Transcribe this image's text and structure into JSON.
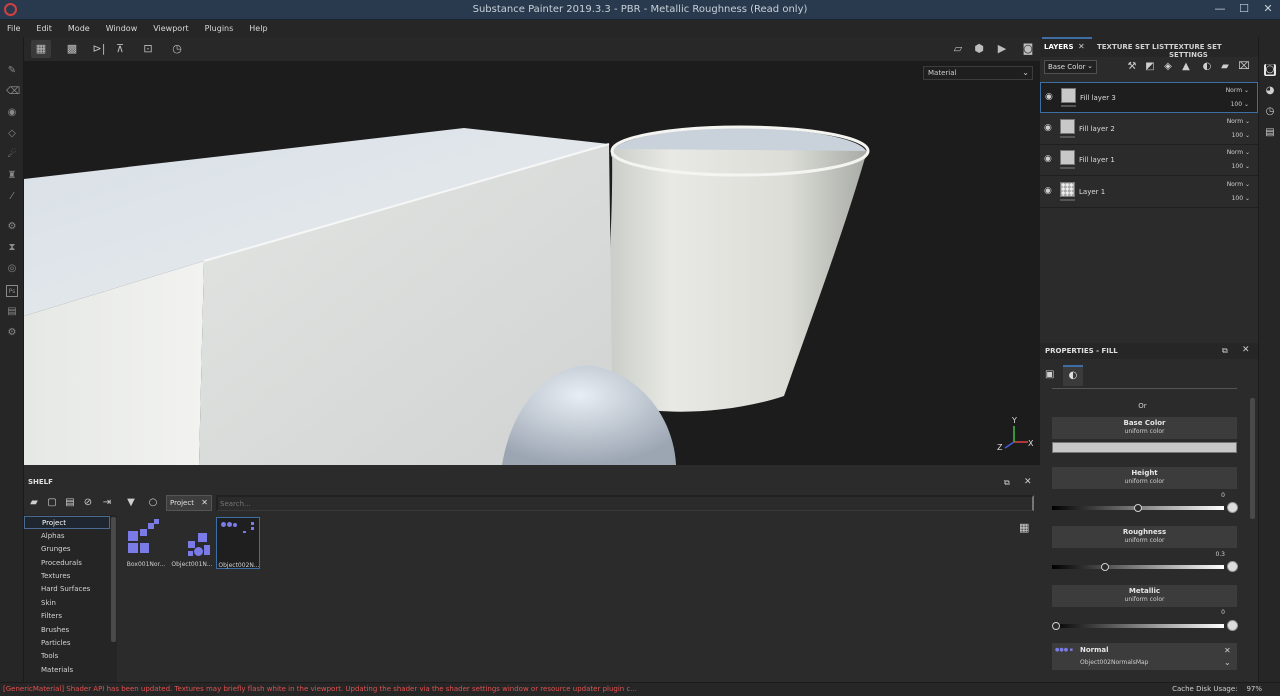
{
  "window": {
    "title": "Substance Painter 2019.3.3 - PBR - Metallic Roughness (Read only)",
    "minimize": "—",
    "maximize": "☐",
    "close": "✕"
  },
  "menu": [
    "File",
    "Edit",
    "Mode",
    "Window",
    "Viewport",
    "Plugins",
    "Help"
  ],
  "viewport": {
    "display_mode": "Material",
    "axis_labels": {
      "x": "X",
      "y": "Y",
      "z": "Z"
    }
  },
  "shelf": {
    "title": "SHELF",
    "tab_label": "Project",
    "search_placeholder": "Search...",
    "categories": [
      "Project",
      "Alphas",
      "Grunges",
      "Procedurals",
      "Textures",
      "Hard Surfaces",
      "Skin",
      "Filters",
      "Brushes",
      "Particles",
      "Tools",
      "Materials"
    ],
    "selected_category": "Project",
    "assets": [
      {
        "name": "Box001Nor..."
      },
      {
        "name": "Object001N..."
      },
      {
        "name": "Object002N..."
      }
    ]
  },
  "layers_panel": {
    "tabs": [
      "LAYERS",
      "TEXTURE SET LIST",
      "TEXTURE SET SETTINGS"
    ],
    "active_tab": "LAYERS",
    "channel_select": "Base Color",
    "layers": [
      {
        "name": "Fill layer 3",
        "blend": "Norm",
        "opacity": "100",
        "selected": true
      },
      {
        "name": "Fill layer 2",
        "blend": "Norm",
        "opacity": "100",
        "selected": false
      },
      {
        "name": "Fill layer 1",
        "blend": "Norm",
        "opacity": "100",
        "selected": false
      },
      {
        "name": "Layer 1",
        "blend": "Norm",
        "opacity": "100",
        "selected": false
      }
    ]
  },
  "properties": {
    "title": "PROPERTIES - FILL",
    "or_label": "Or",
    "base_color": {
      "title": "Base Color",
      "subtitle": "uniform color"
    },
    "height": {
      "title": "Height",
      "subtitle": "uniform color",
      "value": "0",
      "fraction": 0.5
    },
    "roughness": {
      "title": "Roughness",
      "subtitle": "uniform color",
      "value": "0.3",
      "fraction": 0.3
    },
    "metallic": {
      "title": "Metallic",
      "subtitle": "uniform color",
      "value": "0",
      "fraction": 0.0
    },
    "normal": {
      "title": "Normal",
      "map": "Object002NormalsMap"
    }
  },
  "status": {
    "message": "[GenericMaterial] Shader API has been updated. Textures may briefly flash white in the viewport. Updating the shader via the shader settings window or resource updater plugin c...",
    "cache_label": "Cache Disk Usage:",
    "cache_value": "97%"
  },
  "colors": {
    "accent": "#3d6fa5",
    "asset_icon": "#7b7be8",
    "error_text": "#e05050"
  }
}
